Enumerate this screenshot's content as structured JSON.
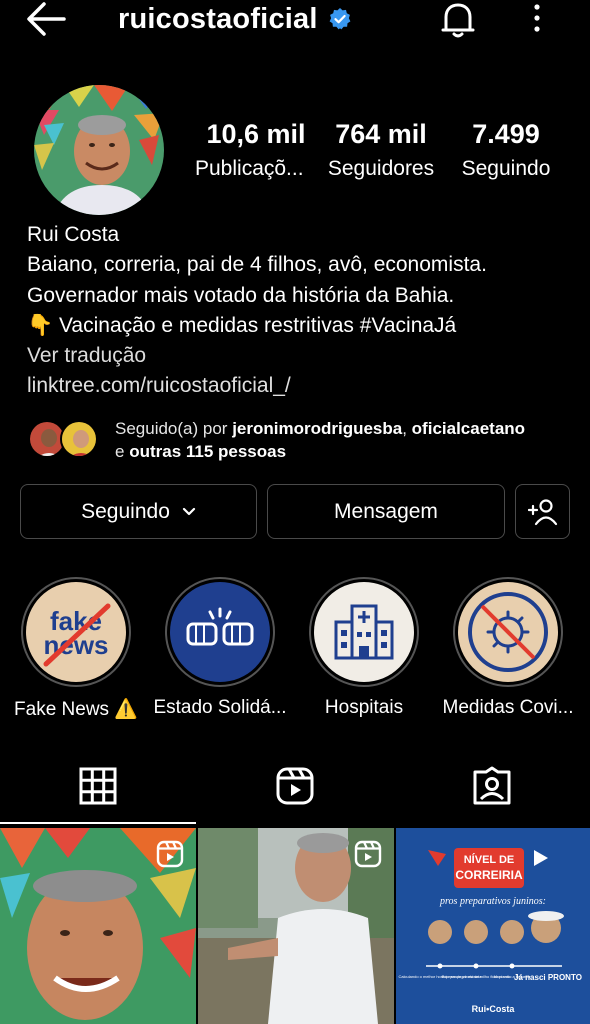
{
  "header": {
    "username": "ruicostaoficial",
    "verified": true
  },
  "stats": {
    "posts": {
      "value": "10,6 mil",
      "label": "Publicaçõ..."
    },
    "followers": {
      "value": "764 mil",
      "label": "Seguidores"
    },
    "following": {
      "value": "7.499",
      "label": "Seguindo"
    }
  },
  "bio": {
    "name": "Rui Costa",
    "line1": "Baiano, correria, pai de 4 filhos, avô, economista.",
    "line2": "Governador mais votado da história da Bahia.",
    "line3": "👇 Vacinação e medidas restritivas  #VacinaJá",
    "translate": "Ver tradução",
    "link": "linktree.com/ruicostaoficial_/"
  },
  "followed_by": {
    "prefix": "Seguido(a) por ",
    "user1": "jeronimorodriguesba",
    "sep": ", ",
    "user2": "oficialcaetano",
    "connector": "e ",
    "others": "outras 115 pessoas"
  },
  "actions": {
    "following_label": "Seguindo",
    "message_label": "Mensagem"
  },
  "highlights": [
    {
      "label": "Fake News ⚠️",
      "cover_text_1": "fake",
      "cover_text_2": "news"
    },
    {
      "label": "Estado Solidá..."
    },
    {
      "label": "Hospitais"
    },
    {
      "label": "Medidas Covi..."
    }
  ],
  "posts": {
    "post3_title_1": "NÍVEL DE",
    "post3_title_2": "CORREIRIA",
    "post3_subtitle": "pros preparativos juninos:",
    "post3_items": [
      "Calculando o melhor horário pra pegar estrada",
      "Esperando o bolo de milho ficar pronto",
      "Montando a fogueira",
      "Já nasci PRONTO"
    ],
    "post3_brand": "Rui•Costa"
  },
  "colors": {
    "background": "#000000",
    "verified_blue": "#3897f0",
    "highlight_beige": "#e8cfae",
    "highlight_navy": "#1f3f8f",
    "post_blue": "#1d4f9c",
    "post_red": "#e23b2e"
  }
}
